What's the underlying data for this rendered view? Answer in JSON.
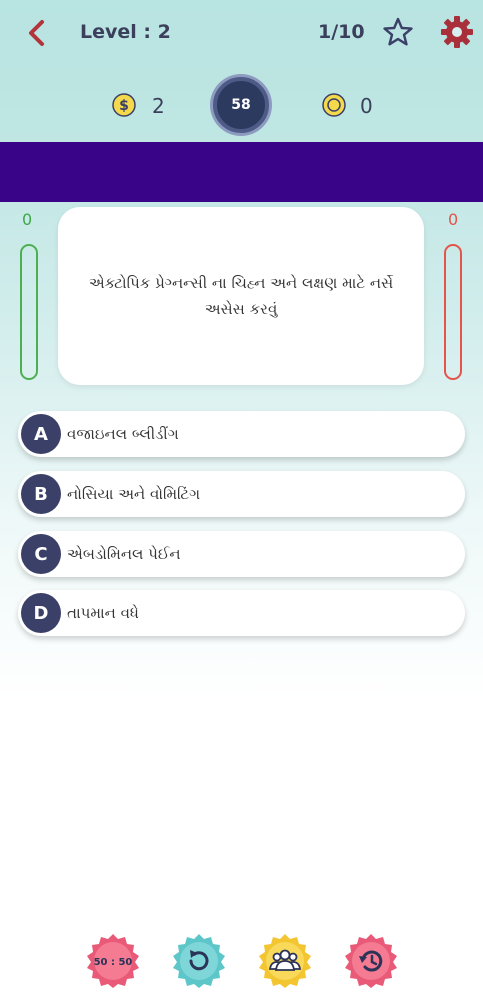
{
  "header": {
    "level_label": "Level : 2",
    "progress": "1/10"
  },
  "stats": {
    "coins": "2",
    "timer": "58",
    "gold": "0"
  },
  "scores": {
    "left": "0",
    "right": "0"
  },
  "question": {
    "text": "એક્ટોપિક પ્રેગ્નન્સી ના ચિહ્ન અને લક્ષણ માટે નર્સે અસેસ કરવું"
  },
  "options": [
    {
      "letter": "A",
      "text": "વજાઇનલ બ્લીડીંગ"
    },
    {
      "letter": "B",
      "text": "નોસિયા અને વોમિટિંગ"
    },
    {
      "letter": "C",
      "text": "એબડોમિનલ પેઈન"
    },
    {
      "letter": "D",
      "text": "તાપમાન વધે"
    }
  ],
  "lifelines": {
    "fifty_fifty": "50 : 50"
  },
  "colors": {
    "banner": "#3a0489",
    "accent": "#3a4067",
    "left_score": "#3ea848",
    "right_score": "#e3544b"
  }
}
